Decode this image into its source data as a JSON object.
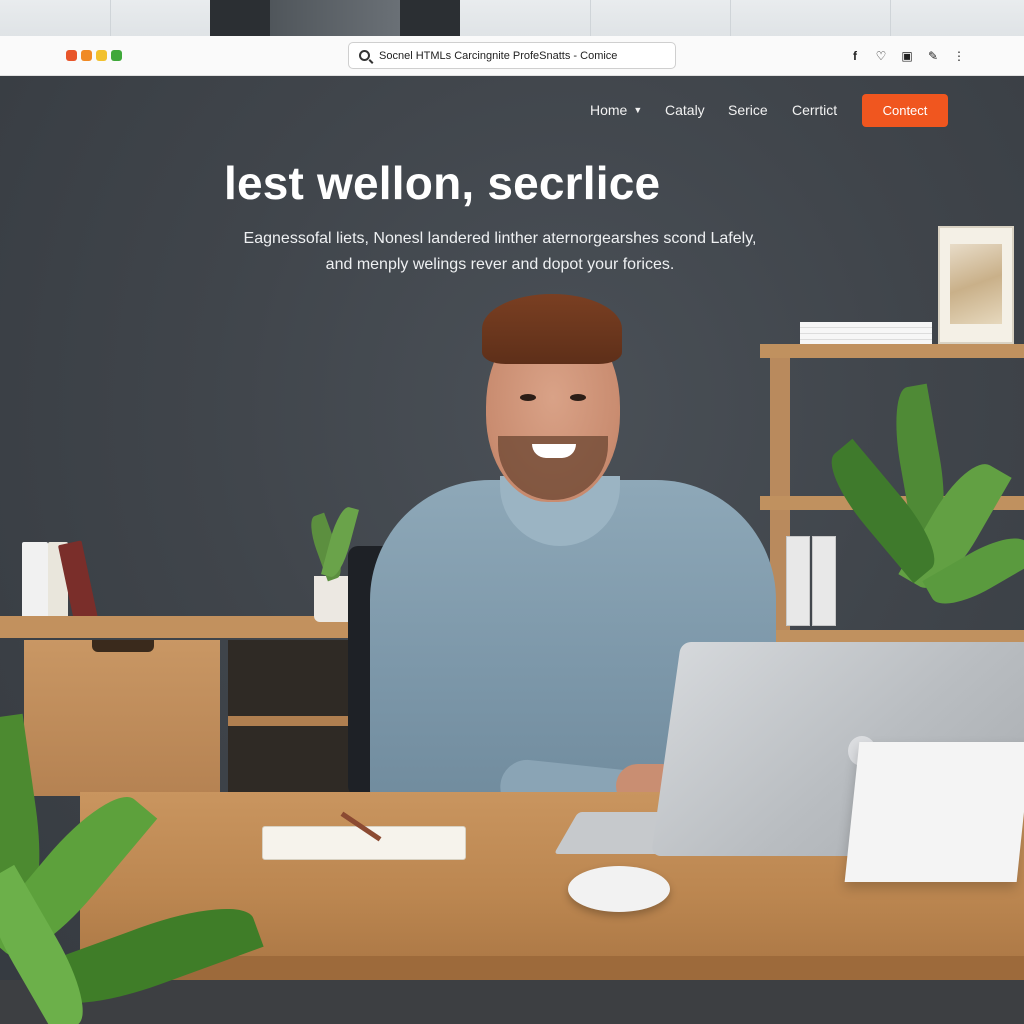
{
  "browser": {
    "window_dots": [
      {
        "name": "red-dot",
        "color": "#e8552a"
      },
      {
        "name": "orange-dot",
        "color": "#f08a24"
      },
      {
        "name": "yellow-dot",
        "color": "#f2c12e"
      },
      {
        "name": "green-dot",
        "color": "#3fa83a"
      }
    ],
    "address_text": "Socnel HTMLs Carcingnite ProfeSnatts - Comice",
    "toolbar_icons": [
      "facebook-icon",
      "heart-icon",
      "clipboard-icon",
      "pen-icon",
      "more-icon"
    ]
  },
  "nav": {
    "items": [
      {
        "label": "Home",
        "has_dropdown": true
      },
      {
        "label": "Cataly"
      },
      {
        "label": "Serice"
      },
      {
        "label": "Cerrtict"
      }
    ],
    "cta_label": "Contect",
    "cta_color": "#f0561f"
  },
  "hero": {
    "title": "lest wellon, secrlice",
    "subtitle_line1": "Eagnessofal liets, Nonesl landered linther aternorgearshes scond Lafely,",
    "subtitle_line2": "and menply welings rever and dopot your forices."
  }
}
